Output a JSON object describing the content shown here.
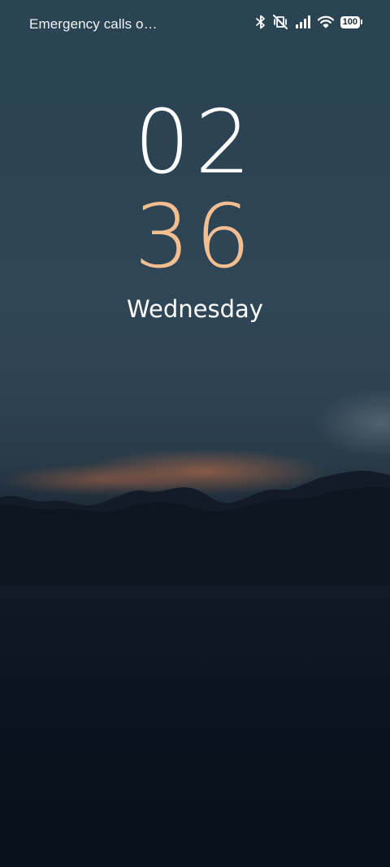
{
  "status_bar": {
    "carrier_text": "Emergency calls o…",
    "icons": [
      "bluetooth-icon",
      "vibrate-off-icon",
      "signal-icon",
      "wifi-icon",
      "battery-icon"
    ],
    "battery_level": "100"
  },
  "lock_screen": {
    "hour": "02",
    "minute": "36",
    "day": "Wednesday"
  },
  "colors": {
    "minute_accent": "#f3be90",
    "text": "#ffffff"
  }
}
